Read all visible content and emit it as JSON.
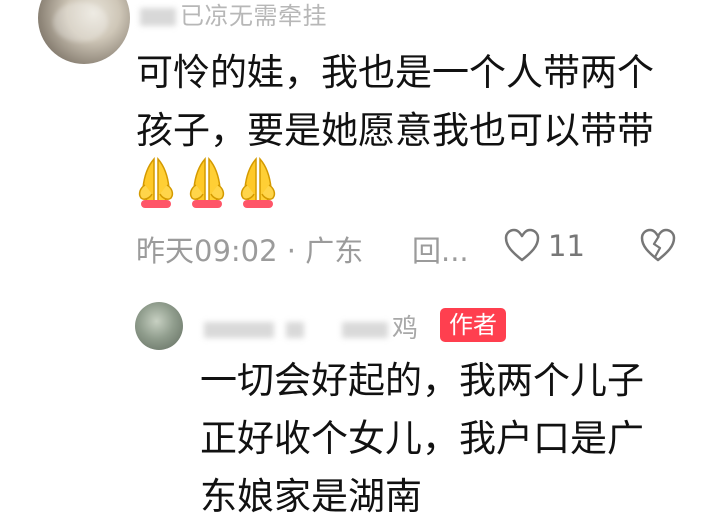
{
  "comment": {
    "username": "已凉无需牵挂",
    "text": "可怜的娃，我也是一个人带两个孩子，要是她愿意我也可以带带",
    "emojis": [
      "pray-emoji",
      "pray-emoji",
      "pray-emoji"
    ],
    "time": "昨天09:02 · 广东",
    "reply_label": "回...",
    "like_count": "11"
  },
  "reply": {
    "username": "鸡",
    "badge": "作者",
    "text": "一切会好起的，我两个儿子正好收个女儿，我户口是广东娘家是湖南"
  },
  "colors": {
    "badge_bg": "#ff3f4f",
    "meta_text": "#9b9b9b",
    "username_text": "#b7b7b7"
  },
  "icons": [
    "heart-icon",
    "broken-heart-icon",
    "pray-emoji"
  ]
}
